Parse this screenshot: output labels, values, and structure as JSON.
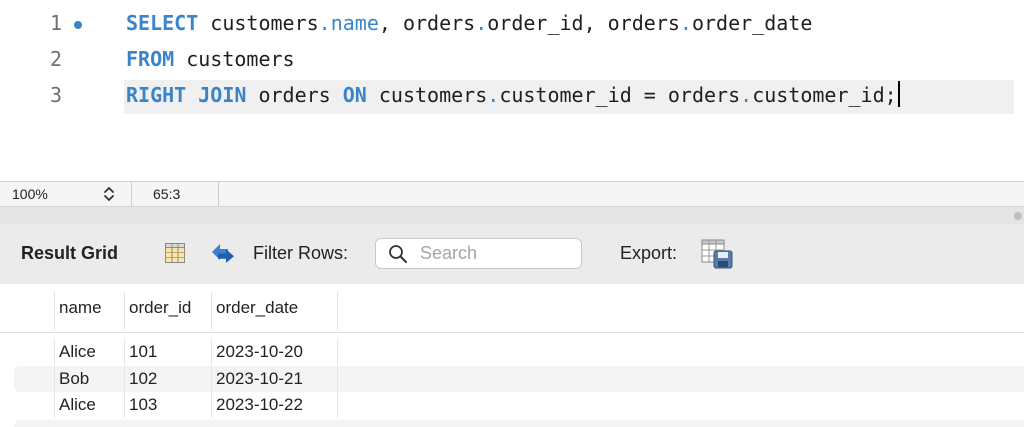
{
  "editor": {
    "lines": [
      {
        "number": "1"
      },
      {
        "number": "2"
      },
      {
        "number": "3"
      }
    ],
    "tokens": {
      "l1_kw_select": "SELECT",
      "l1_a": " customers",
      "l1_dot1": ".",
      "l1_name": "name",
      "l1_b": ", orders",
      "l1_dot2": ".",
      "l1_c": "order_id, orders",
      "l1_dot3": ".",
      "l1_d": "order_date",
      "l2_kw_from": "FROM",
      "l2_a": " customers",
      "l3_kw_right_join": "RIGHT JOIN",
      "l3_a": " orders ",
      "l3_kw_on": "ON",
      "l3_b": " customers",
      "l3_dot1": ".",
      "l3_c": "customer_id = orders",
      "l3_dot2": ".",
      "l3_d": "customer_id;"
    }
  },
  "statusbar": {
    "zoom": "100%",
    "cursor_position": "65:3"
  },
  "result_toolbar": {
    "title": "Result Grid",
    "filter_label": "Filter Rows:",
    "search_placeholder": "Search",
    "search_value": "",
    "export_label": "Export:"
  },
  "grid": {
    "columns": [
      "name",
      "order_id",
      "order_date"
    ],
    "rows": [
      [
        "Alice",
        "101",
        "2023-10-20"
      ],
      [
        "Bob",
        "102",
        "2023-10-21"
      ],
      [
        "Alice",
        "103",
        "2023-10-22"
      ]
    ]
  },
  "icons": {
    "breakpoint": "breakpoint-dot-icon",
    "zoom_stepper": "chevron-updown-icon",
    "grid_toggle": "grid-form-icon",
    "refresh": "refresh-icon",
    "search": "magnifier-icon",
    "export": "export-spreadsheet-icon"
  },
  "colors": {
    "keyword": "#3a84c9",
    "breakpoint": "#3a84c9",
    "active_line_bg": "#f0f0f0",
    "toolbar_bg": "#ebebeb"
  }
}
